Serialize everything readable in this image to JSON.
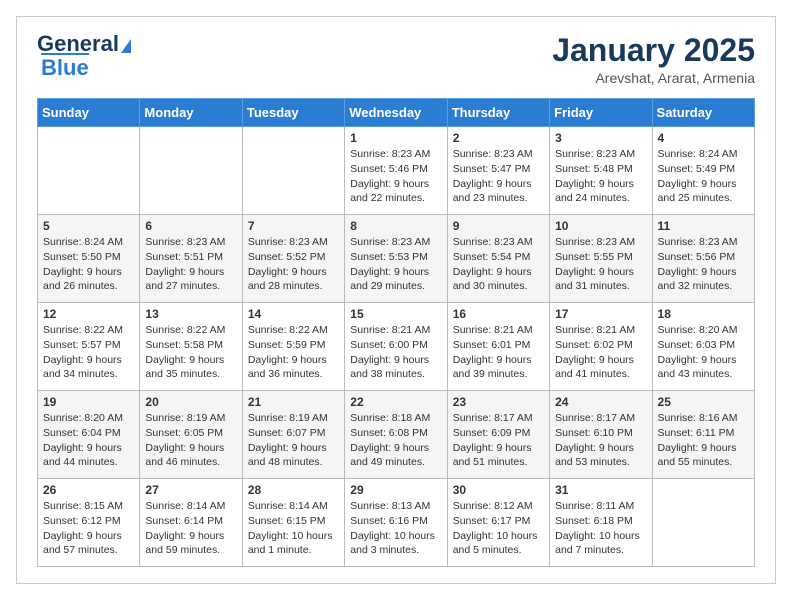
{
  "logo": {
    "line1": "General",
    "line2": "Blue"
  },
  "header": {
    "month": "January 2025",
    "location": "Arevshat, Ararat, Armenia"
  },
  "weekdays": [
    "Sunday",
    "Monday",
    "Tuesday",
    "Wednesday",
    "Thursday",
    "Friday",
    "Saturday"
  ],
  "weeks": [
    [
      {
        "day": "",
        "sunrise": "",
        "sunset": "",
        "daylight": ""
      },
      {
        "day": "",
        "sunrise": "",
        "sunset": "",
        "daylight": ""
      },
      {
        "day": "",
        "sunrise": "",
        "sunset": "",
        "daylight": ""
      },
      {
        "day": "1",
        "sunrise": "Sunrise: 8:23 AM",
        "sunset": "Sunset: 5:46 PM",
        "daylight": "Daylight: 9 hours and 22 minutes."
      },
      {
        "day": "2",
        "sunrise": "Sunrise: 8:23 AM",
        "sunset": "Sunset: 5:47 PM",
        "daylight": "Daylight: 9 hours and 23 minutes."
      },
      {
        "day": "3",
        "sunrise": "Sunrise: 8:23 AM",
        "sunset": "Sunset: 5:48 PM",
        "daylight": "Daylight: 9 hours and 24 minutes."
      },
      {
        "day": "4",
        "sunrise": "Sunrise: 8:24 AM",
        "sunset": "Sunset: 5:49 PM",
        "daylight": "Daylight: 9 hours and 25 minutes."
      }
    ],
    [
      {
        "day": "5",
        "sunrise": "Sunrise: 8:24 AM",
        "sunset": "Sunset: 5:50 PM",
        "daylight": "Daylight: 9 hours and 26 minutes."
      },
      {
        "day": "6",
        "sunrise": "Sunrise: 8:23 AM",
        "sunset": "Sunset: 5:51 PM",
        "daylight": "Daylight: 9 hours and 27 minutes."
      },
      {
        "day": "7",
        "sunrise": "Sunrise: 8:23 AM",
        "sunset": "Sunset: 5:52 PM",
        "daylight": "Daylight: 9 hours and 28 minutes."
      },
      {
        "day": "8",
        "sunrise": "Sunrise: 8:23 AM",
        "sunset": "Sunset: 5:53 PM",
        "daylight": "Daylight: 9 hours and 29 minutes."
      },
      {
        "day": "9",
        "sunrise": "Sunrise: 8:23 AM",
        "sunset": "Sunset: 5:54 PM",
        "daylight": "Daylight: 9 hours and 30 minutes."
      },
      {
        "day": "10",
        "sunrise": "Sunrise: 8:23 AM",
        "sunset": "Sunset: 5:55 PM",
        "daylight": "Daylight: 9 hours and 31 minutes."
      },
      {
        "day": "11",
        "sunrise": "Sunrise: 8:23 AM",
        "sunset": "Sunset: 5:56 PM",
        "daylight": "Daylight: 9 hours and 32 minutes."
      }
    ],
    [
      {
        "day": "12",
        "sunrise": "Sunrise: 8:22 AM",
        "sunset": "Sunset: 5:57 PM",
        "daylight": "Daylight: 9 hours and 34 minutes."
      },
      {
        "day": "13",
        "sunrise": "Sunrise: 8:22 AM",
        "sunset": "Sunset: 5:58 PM",
        "daylight": "Daylight: 9 hours and 35 minutes."
      },
      {
        "day": "14",
        "sunrise": "Sunrise: 8:22 AM",
        "sunset": "Sunset: 5:59 PM",
        "daylight": "Daylight: 9 hours and 36 minutes."
      },
      {
        "day": "15",
        "sunrise": "Sunrise: 8:21 AM",
        "sunset": "Sunset: 6:00 PM",
        "daylight": "Daylight: 9 hours and 38 minutes."
      },
      {
        "day": "16",
        "sunrise": "Sunrise: 8:21 AM",
        "sunset": "Sunset: 6:01 PM",
        "daylight": "Daylight: 9 hours and 39 minutes."
      },
      {
        "day": "17",
        "sunrise": "Sunrise: 8:21 AM",
        "sunset": "Sunset: 6:02 PM",
        "daylight": "Daylight: 9 hours and 41 minutes."
      },
      {
        "day": "18",
        "sunrise": "Sunrise: 8:20 AM",
        "sunset": "Sunset: 6:03 PM",
        "daylight": "Daylight: 9 hours and 43 minutes."
      }
    ],
    [
      {
        "day": "19",
        "sunrise": "Sunrise: 8:20 AM",
        "sunset": "Sunset: 6:04 PM",
        "daylight": "Daylight: 9 hours and 44 minutes."
      },
      {
        "day": "20",
        "sunrise": "Sunrise: 8:19 AM",
        "sunset": "Sunset: 6:05 PM",
        "daylight": "Daylight: 9 hours and 46 minutes."
      },
      {
        "day": "21",
        "sunrise": "Sunrise: 8:19 AM",
        "sunset": "Sunset: 6:07 PM",
        "daylight": "Daylight: 9 hours and 48 minutes."
      },
      {
        "day": "22",
        "sunrise": "Sunrise: 8:18 AM",
        "sunset": "Sunset: 6:08 PM",
        "daylight": "Daylight: 9 hours and 49 minutes."
      },
      {
        "day": "23",
        "sunrise": "Sunrise: 8:17 AM",
        "sunset": "Sunset: 6:09 PM",
        "daylight": "Daylight: 9 hours and 51 minutes."
      },
      {
        "day": "24",
        "sunrise": "Sunrise: 8:17 AM",
        "sunset": "Sunset: 6:10 PM",
        "daylight": "Daylight: 9 hours and 53 minutes."
      },
      {
        "day": "25",
        "sunrise": "Sunrise: 8:16 AM",
        "sunset": "Sunset: 6:11 PM",
        "daylight": "Daylight: 9 hours and 55 minutes."
      }
    ],
    [
      {
        "day": "26",
        "sunrise": "Sunrise: 8:15 AM",
        "sunset": "Sunset: 6:12 PM",
        "daylight": "Daylight: 9 hours and 57 minutes."
      },
      {
        "day": "27",
        "sunrise": "Sunrise: 8:14 AM",
        "sunset": "Sunset: 6:14 PM",
        "daylight": "Daylight: 9 hours and 59 minutes."
      },
      {
        "day": "28",
        "sunrise": "Sunrise: 8:14 AM",
        "sunset": "Sunset: 6:15 PM",
        "daylight": "Daylight: 10 hours and 1 minute."
      },
      {
        "day": "29",
        "sunrise": "Sunrise: 8:13 AM",
        "sunset": "Sunset: 6:16 PM",
        "daylight": "Daylight: 10 hours and 3 minutes."
      },
      {
        "day": "30",
        "sunrise": "Sunrise: 8:12 AM",
        "sunset": "Sunset: 6:17 PM",
        "daylight": "Daylight: 10 hours and 5 minutes."
      },
      {
        "day": "31",
        "sunrise": "Sunrise: 8:11 AM",
        "sunset": "Sunset: 6:18 PM",
        "daylight": "Daylight: 10 hours and 7 minutes."
      },
      {
        "day": "",
        "sunrise": "",
        "sunset": "",
        "daylight": ""
      }
    ]
  ]
}
